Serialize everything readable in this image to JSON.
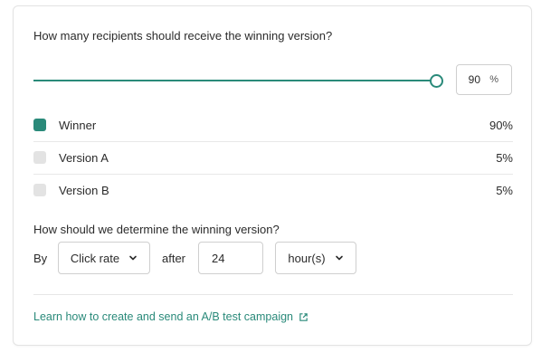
{
  "distribution": {
    "question": "How many recipients should receive the winning version?",
    "slider_value": 90,
    "input_value": "90",
    "input_unit": "%",
    "rows": [
      {
        "label": "Winner",
        "value": "90%",
        "color": "#2a8a7a"
      },
      {
        "label": "Version A",
        "value": "5%",
        "color": "#e3e3e3"
      },
      {
        "label": "Version B",
        "value": "5%",
        "color": "#e3e3e3"
      }
    ]
  },
  "determine": {
    "question": "How should we determine the winning version?",
    "by_label": "By",
    "metric_select": "Click rate",
    "after_label": "after",
    "duration_value": "24",
    "unit_select": "hour(s)"
  },
  "footer": {
    "link_text": "Learn how to create and send an A/B test campaign",
    "link_icon": "external-link-icon"
  },
  "colors": {
    "accent": "#2a8a7a"
  }
}
